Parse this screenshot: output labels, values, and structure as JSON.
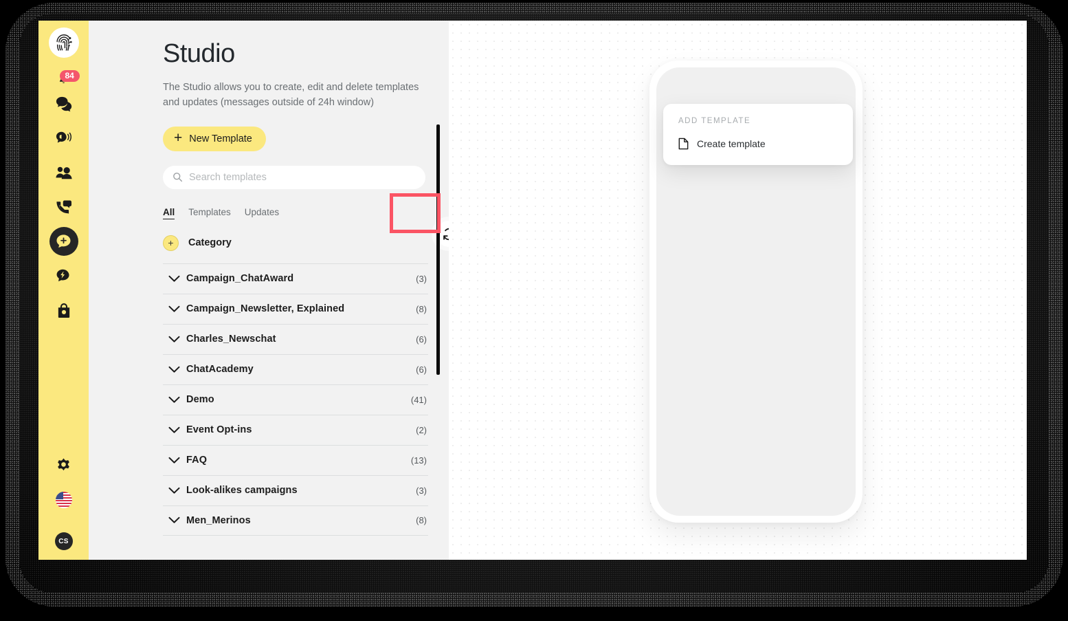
{
  "rail": {
    "logo_icon": "fingerprint-logo",
    "notifications": {
      "icon": "bell-icon",
      "count": "84"
    },
    "items": [
      {
        "icon": "chat-bubbles-icon",
        "name": "conversations",
        "active": false
      },
      {
        "icon": "megaphone-bubble-icon",
        "name": "broadcasts",
        "active": false
      },
      {
        "icon": "people-group-icon",
        "name": "contacts",
        "active": false
      },
      {
        "icon": "call-bubble-icon",
        "name": "calls",
        "active": false
      },
      {
        "icon": "add-bubble-icon",
        "name": "studio",
        "active": true
      },
      {
        "icon": "lightning-bubble-icon",
        "name": "automations",
        "active": false
      },
      {
        "icon": "shopping-bag-icon",
        "name": "commerce",
        "active": false
      }
    ],
    "bottom": [
      {
        "icon": "gear-icon",
        "name": "settings"
      },
      {
        "icon": "us-flag-icon",
        "name": "language"
      }
    ],
    "avatar_initials": "CS"
  },
  "panel": {
    "title": "Studio",
    "description": "The Studio allows you to create, edit and delete templates and updates (messages outside of 24h window)",
    "new_template_label": "New Template",
    "new_template_plus": "+",
    "search": {
      "placeholder": "Search templates",
      "value": "",
      "icon": "search-icon"
    },
    "tabs": [
      {
        "label": "All",
        "active": true
      },
      {
        "label": "Templates",
        "active": false
      },
      {
        "label": "Updates",
        "active": false
      }
    ],
    "refresh": {
      "icon": "refresh-icon",
      "label": "Refresh"
    },
    "category": {
      "label": "Category",
      "plus": "+"
    },
    "categories": [
      {
        "name": "Campaign_ChatAward",
        "count": "(3)"
      },
      {
        "name": "Campaign_Newsletter, Explained",
        "count": "(8)"
      },
      {
        "name": "Charles_Newschat",
        "count": "(6)"
      },
      {
        "name": "ChatAcademy",
        "count": "(6)"
      },
      {
        "name": "Demo",
        "count": "(41)"
      },
      {
        "name": "Event Opt-ins",
        "count": "(2)"
      },
      {
        "name": "FAQ",
        "count": "(13)"
      },
      {
        "name": "Look-alikes campaigns",
        "count": "(3)"
      },
      {
        "name": "Men_Merinos",
        "count": "(8)"
      }
    ]
  },
  "preview": {
    "menu": {
      "title": "ADD TEMPLATE",
      "items": [
        {
          "label": "Create template",
          "icon": "document-icon"
        }
      ]
    }
  },
  "colors": {
    "brand_yellow": "#fbe87f",
    "dark": "#262626",
    "highlight_red": "#fb5464",
    "badge_red": "#f4566b",
    "panel_bg": "#f2f2f2"
  }
}
